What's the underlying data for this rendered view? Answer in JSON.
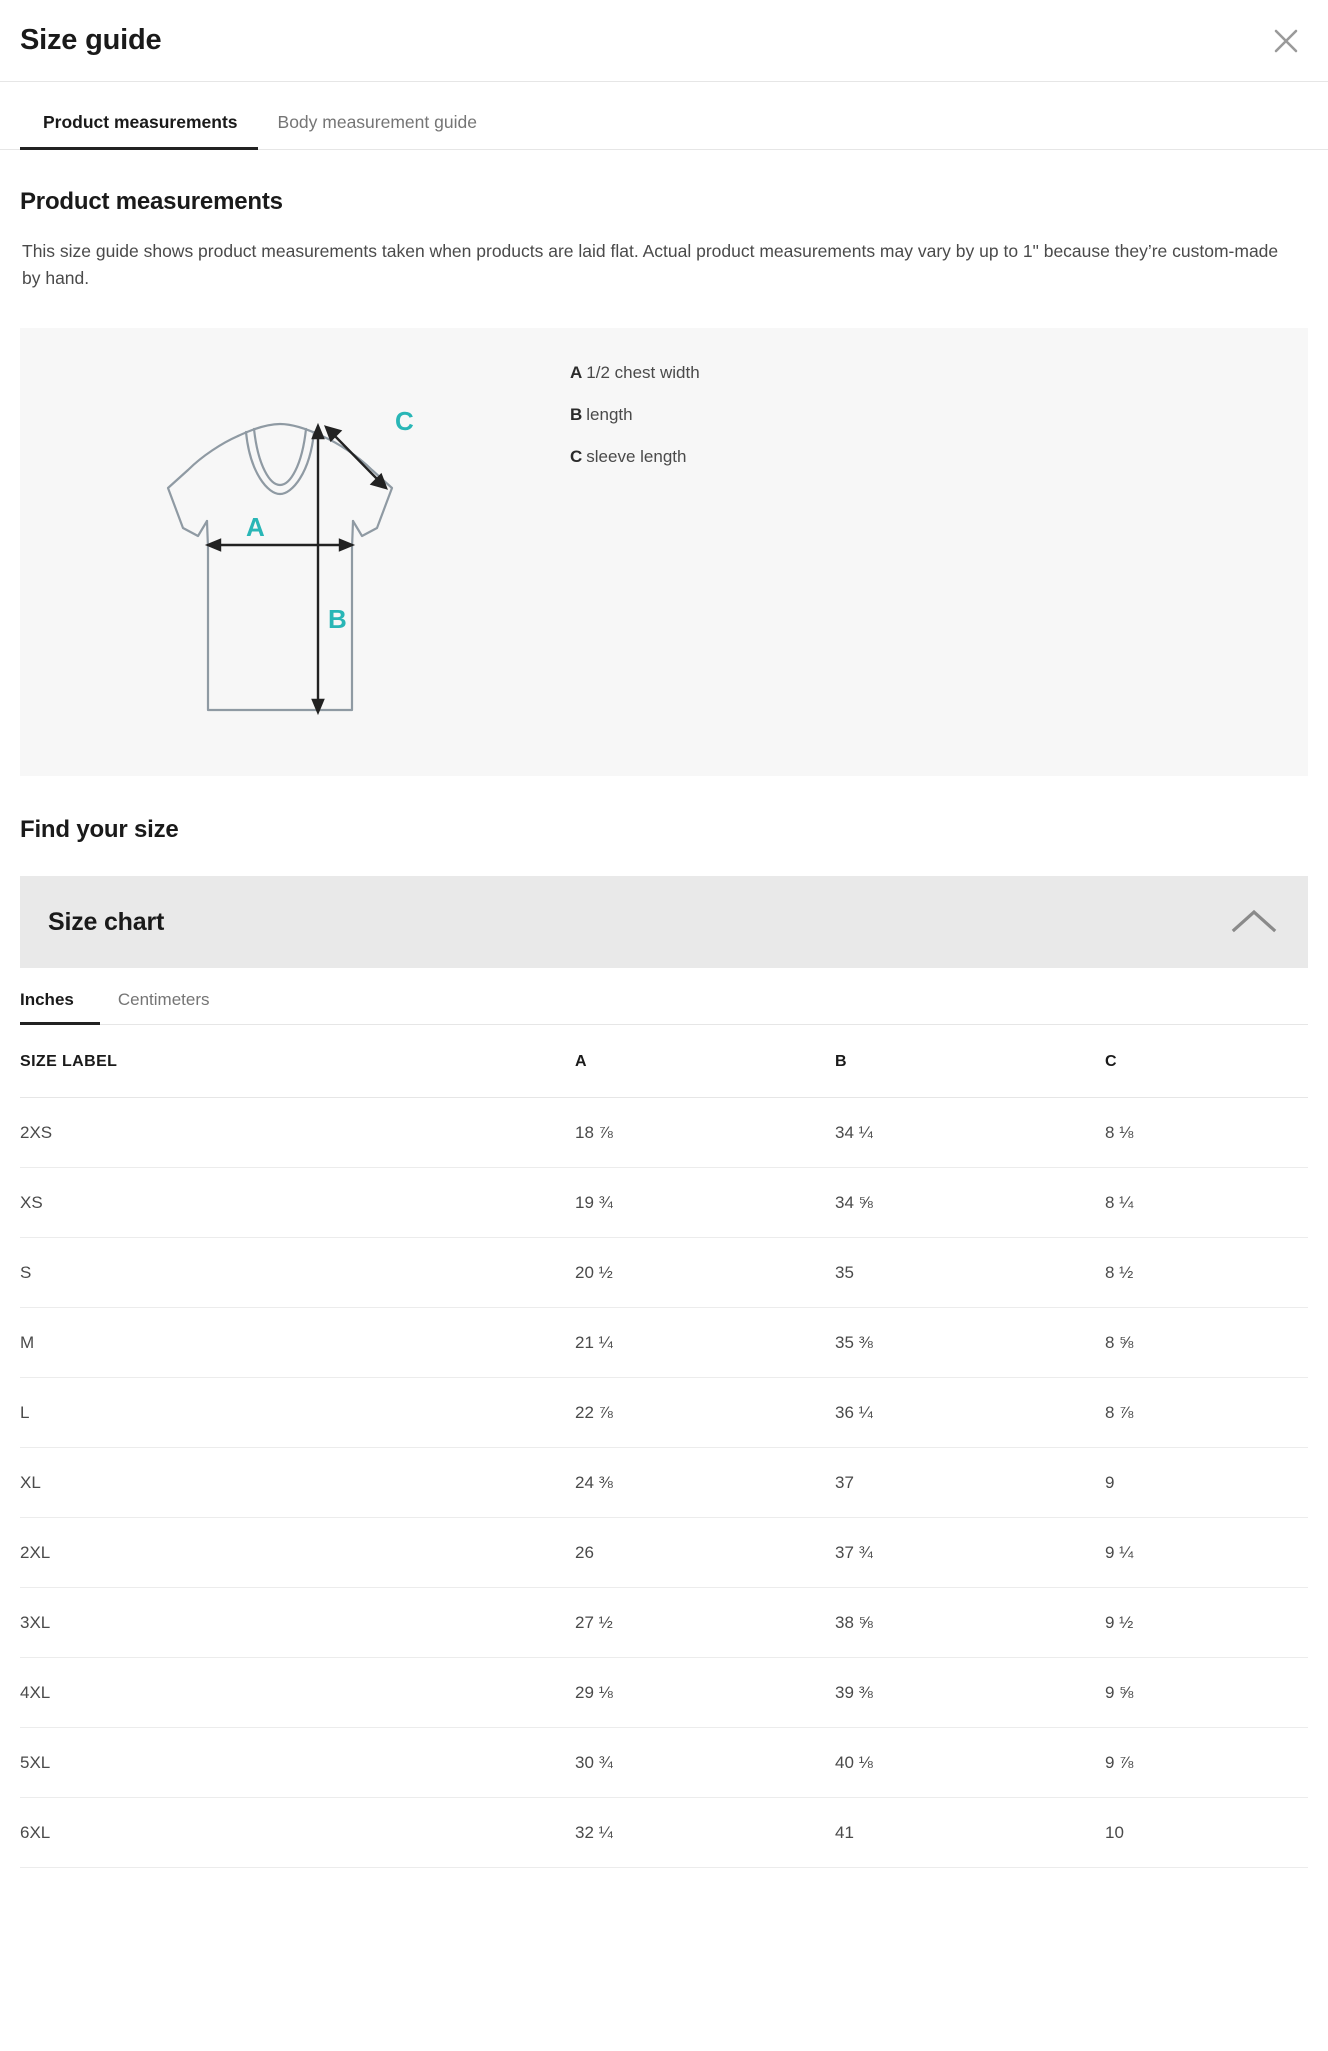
{
  "header": {
    "title": "Size guide",
    "close_icon": "close-icon"
  },
  "tabs": [
    {
      "label": "Product measurements",
      "active": true
    },
    {
      "label": "Body measurement guide",
      "active": false
    }
  ],
  "product_measurements": {
    "heading": "Product measurements",
    "intro": "This size guide shows product measurements taken when products are laid flat. Actual product measurements may vary by up to 1\" because they’re custom-made by hand."
  },
  "diagram": {
    "garment": "t-shirt-outline",
    "accent_color": "#29b6b6",
    "outline_color": "#8f9aa3",
    "arrow_color": "#222222",
    "background": "#f7f7f7",
    "markers": [
      {
        "key": "A",
        "label": "1/2 chest width"
      },
      {
        "key": "B",
        "label": "length"
      },
      {
        "key": "C",
        "label": "sleeve length"
      }
    ]
  },
  "find_your_size": {
    "heading": "Find your size"
  },
  "accordion": {
    "title": "Size chart",
    "expanded": true,
    "chevron_icon": "chevron-up-icon",
    "background": "#e9e9e9"
  },
  "unit_tabs": [
    {
      "label": "Inches",
      "active": true
    },
    {
      "label": "Centimeters",
      "active": false
    }
  ],
  "chart_data": {
    "type": "table",
    "title": "Size chart",
    "unit": "Inches",
    "columns": [
      "SIZE LABEL",
      "A",
      "B",
      "C"
    ],
    "rows": [
      {
        "size": "2XS",
        "a": "18 ⅞",
        "b": "34 ¼",
        "c": "8 ⅛"
      },
      {
        "size": "XS",
        "a": "19 ¾",
        "b": "34 ⅝",
        "c": "8 ¼"
      },
      {
        "size": "S",
        "a": "20 ½",
        "b": "35",
        "c": "8 ½"
      },
      {
        "size": "M",
        "a": "21 ¼",
        "b": "35 ⅜",
        "c": "8 ⅝"
      },
      {
        "size": "L",
        "a": "22 ⅞",
        "b": "36 ¼",
        "c": "8 ⅞"
      },
      {
        "size": "XL",
        "a": "24 ⅜",
        "b": "37",
        "c": "9"
      },
      {
        "size": "2XL",
        "a": "26",
        "b": "37 ¾",
        "c": "9 ¼"
      },
      {
        "size": "3XL",
        "a": "27 ½",
        "b": "38 ⅝",
        "c": "9 ½"
      },
      {
        "size": "4XL",
        "a": "29 ⅛",
        "b": "39 ⅜",
        "c": "9 ⅝"
      },
      {
        "size": "5XL",
        "a": "30 ¾",
        "b": "40 ⅛",
        "c": "9 ⅞"
      },
      {
        "size": "6XL",
        "a": "32 ¼",
        "b": "41",
        "c": "10"
      }
    ]
  }
}
